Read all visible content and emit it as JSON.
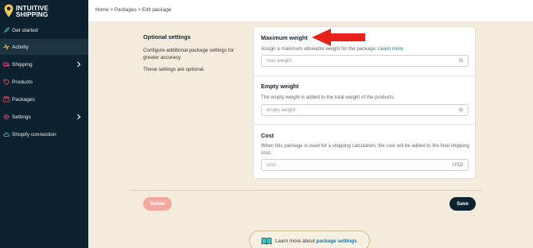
{
  "brand": {
    "line1": "INTUITIVE",
    "line2": "SHIPPING",
    "accent": "#f2c94c"
  },
  "sidebar": {
    "items": [
      {
        "label": "Get started",
        "icon": "rocket-icon",
        "chevron": false
      },
      {
        "label": "Activity",
        "icon": "activity-icon",
        "chevron": false,
        "active": true
      },
      {
        "label": "Shipping",
        "icon": "truck-icon",
        "chevron": true
      },
      {
        "label": "Products",
        "icon": "tag-icon",
        "chevron": false
      },
      {
        "label": "Packages",
        "icon": "box-icon",
        "chevron": false
      },
      {
        "label": "Settings",
        "icon": "gear-icon",
        "chevron": true
      },
      {
        "label": "Shopify connection",
        "icon": "cloud-icon",
        "chevron": false
      }
    ]
  },
  "breadcrumb": "Home > Packages > Edit package",
  "optional": {
    "title": "Optional settings",
    "description": "Configure additional package settings for greater accuracy.",
    "note": "These settings are optional."
  },
  "card": {
    "max_weight": {
      "title": "Maximum weight",
      "description": "Assign a maximum allowable weight for the package.",
      "link": "Learn more.",
      "placeholder": "max weight",
      "unit": "lb"
    },
    "empty_weight": {
      "title": "Empty weight",
      "description": "The empty weight is added to the total weight of the products.",
      "placeholder": "empty weight",
      "unit": "lb"
    },
    "cost": {
      "title": "Cost",
      "description": "When this package is used for a shipping calculation, the cost will be added to the final shipping cost.",
      "placeholder": "cost",
      "unit": "USD"
    }
  },
  "buttons": {
    "delete": "Delete",
    "save": "Save"
  },
  "learn_more": {
    "prefix": "Learn more about ",
    "link": "package settings",
    "suffix": "."
  },
  "colors": {
    "sidebar_bg": "#0d2230",
    "page_bg": "#f3ebdc",
    "delete_bg": "#f2a99f",
    "arrow": "#e8221b",
    "link": "#2a6f97"
  }
}
